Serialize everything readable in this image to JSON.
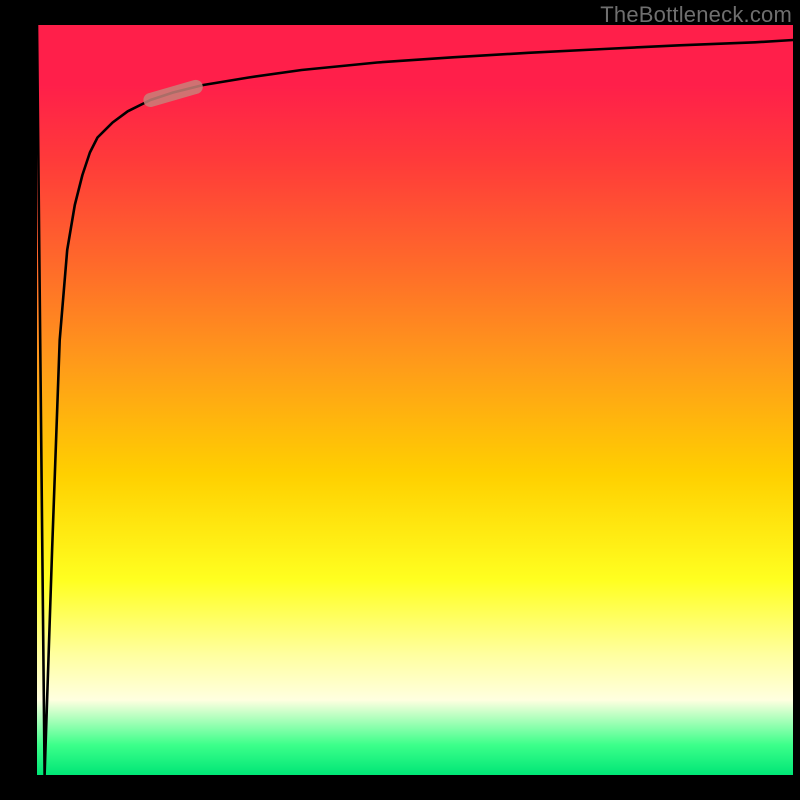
{
  "watermark": "TheBottleneck.com",
  "chart_data": {
    "type": "line",
    "title": "",
    "xlabel": "",
    "ylabel": "",
    "xlim": [
      0,
      100
    ],
    "ylim": [
      0,
      100
    ],
    "grid": false,
    "legend": false,
    "annotations": [
      {
        "kind": "highlight-segment",
        "x_range": [
          15,
          21
        ],
        "style": "thick-rosy"
      }
    ],
    "series": [
      {
        "name": "curve",
        "x": [
          0,
          1,
          2,
          3,
          4,
          5,
          6,
          7,
          8,
          10,
          12,
          15,
          18,
          22,
          28,
          35,
          45,
          55,
          65,
          75,
          85,
          95,
          100
        ],
        "values": [
          100,
          0,
          30,
          58,
          70,
          76,
          80,
          83,
          85,
          87,
          88.5,
          90,
          91,
          92,
          93,
          94,
          95,
          95.7,
          96.3,
          96.8,
          97.3,
          97.7,
          98
        ]
      }
    ]
  }
}
